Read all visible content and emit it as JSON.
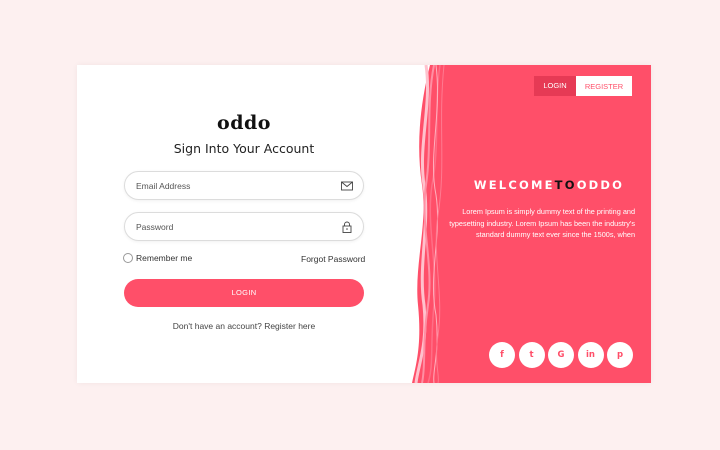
{
  "brand": "oddo",
  "heading": "Sign Into Your Account",
  "form": {
    "email_placeholder": "Email Address",
    "password_placeholder": "Password",
    "remember_label": "Remember me",
    "forgot_label": "Forgot Password",
    "login_button": "LOGIN",
    "register_text": "Don't have an account? Register here"
  },
  "tabs": {
    "login": "LOGIN",
    "register": "REGISTER"
  },
  "welcome": {
    "part1": "WELCOME",
    "part2": "TO",
    "part3": "ODDO"
  },
  "description": "Lorem Ipsum is simply dummy text of the printing and typesetting industry. Lorem Ipsum has been the industry's standard dummy text ever since the 1500s, when",
  "social": [
    {
      "icon": "facebook-icon",
      "glyph": "f"
    },
    {
      "icon": "twitter-icon",
      "glyph": "t"
    },
    {
      "icon": "google-icon",
      "glyph": "G"
    },
    {
      "icon": "linkedin-icon",
      "glyph": "in"
    },
    {
      "icon": "pinterest-icon",
      "glyph": "p"
    }
  ],
  "colors": {
    "accent": "#ff4f69",
    "accent_dark": "#e63a55",
    "background": "#fdf0f0"
  }
}
